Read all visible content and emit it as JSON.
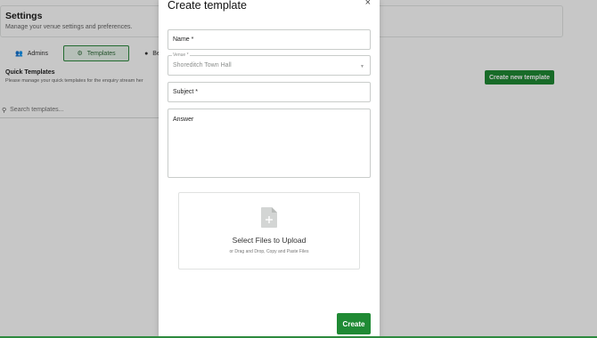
{
  "settings": {
    "title": "Settings",
    "subtitle": "Manage your venue settings and preferences."
  },
  "tabs": [
    {
      "label": "Admins",
      "icon": "users-icon"
    },
    {
      "label": "Templates",
      "icon": "gear-icon",
      "active": true
    },
    {
      "label": "Ben",
      "icon": "pin-icon"
    }
  ],
  "quick_templates": {
    "title": "Quick Templates",
    "subtitle": "Please manage your quick templates for the enquiry stream her"
  },
  "create_new_label": "Create new template",
  "search": {
    "placeholder": "Search templates..."
  },
  "modal": {
    "title": "Create template",
    "close_symbol": "×",
    "name_placeholder": "Name *",
    "venue_label": "Venue *",
    "venue_value": "Shoreditch Town Hall",
    "subject_placeholder": "Subject *",
    "answer_placeholder": "Answer",
    "upload_title": "Select Files to Upload",
    "upload_sub": "or Drag and Drop, Copy and Paste Files",
    "create_label": "Create"
  },
  "colors": {
    "accent": "#1f8a34",
    "overlay": "rgba(0,0,0,0.22)"
  }
}
